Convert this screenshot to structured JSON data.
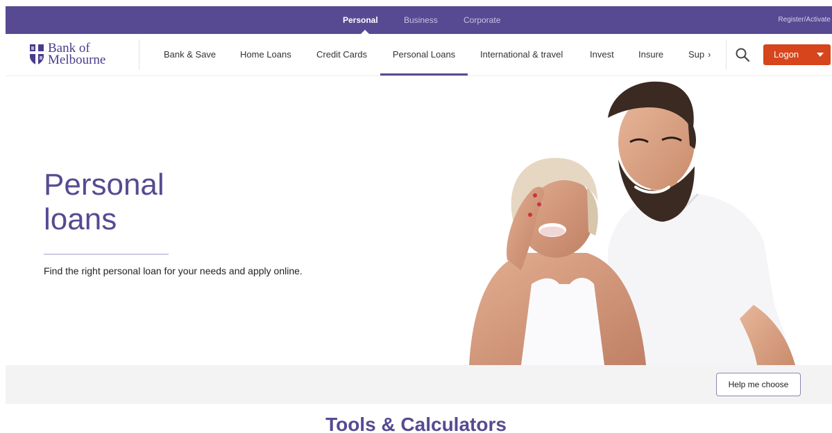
{
  "top_bar": {
    "segments": [
      "Personal",
      "Business",
      "Corporate"
    ],
    "active_segment": "Personal",
    "register_label": "Register/Activate",
    "background_color": "#574a92"
  },
  "brand": {
    "logo_line1": "Bank of",
    "logo_line2": "Melbourne",
    "logo_icon": "shield-icon"
  },
  "nav": {
    "items": [
      "Bank & Save",
      "Home Loans",
      "Credit Cards",
      "Personal Loans",
      "International & travel",
      "Invest",
      "Insure"
    ],
    "more_label": "Sup",
    "active_item": "Personal Loans",
    "search_icon": "search-icon",
    "logon_label": "Logon",
    "logon_color": "#d6451b"
  },
  "hero": {
    "title_line1": "Personal",
    "title_line2": "loans",
    "description": "Find the right personal loan for your needs and apply online.",
    "image_alt": "couple-laughing-photo"
  },
  "strip": {
    "help_button_label": "Help me choose"
  },
  "sections": {
    "tools_title": "Tools & Calculators"
  }
}
